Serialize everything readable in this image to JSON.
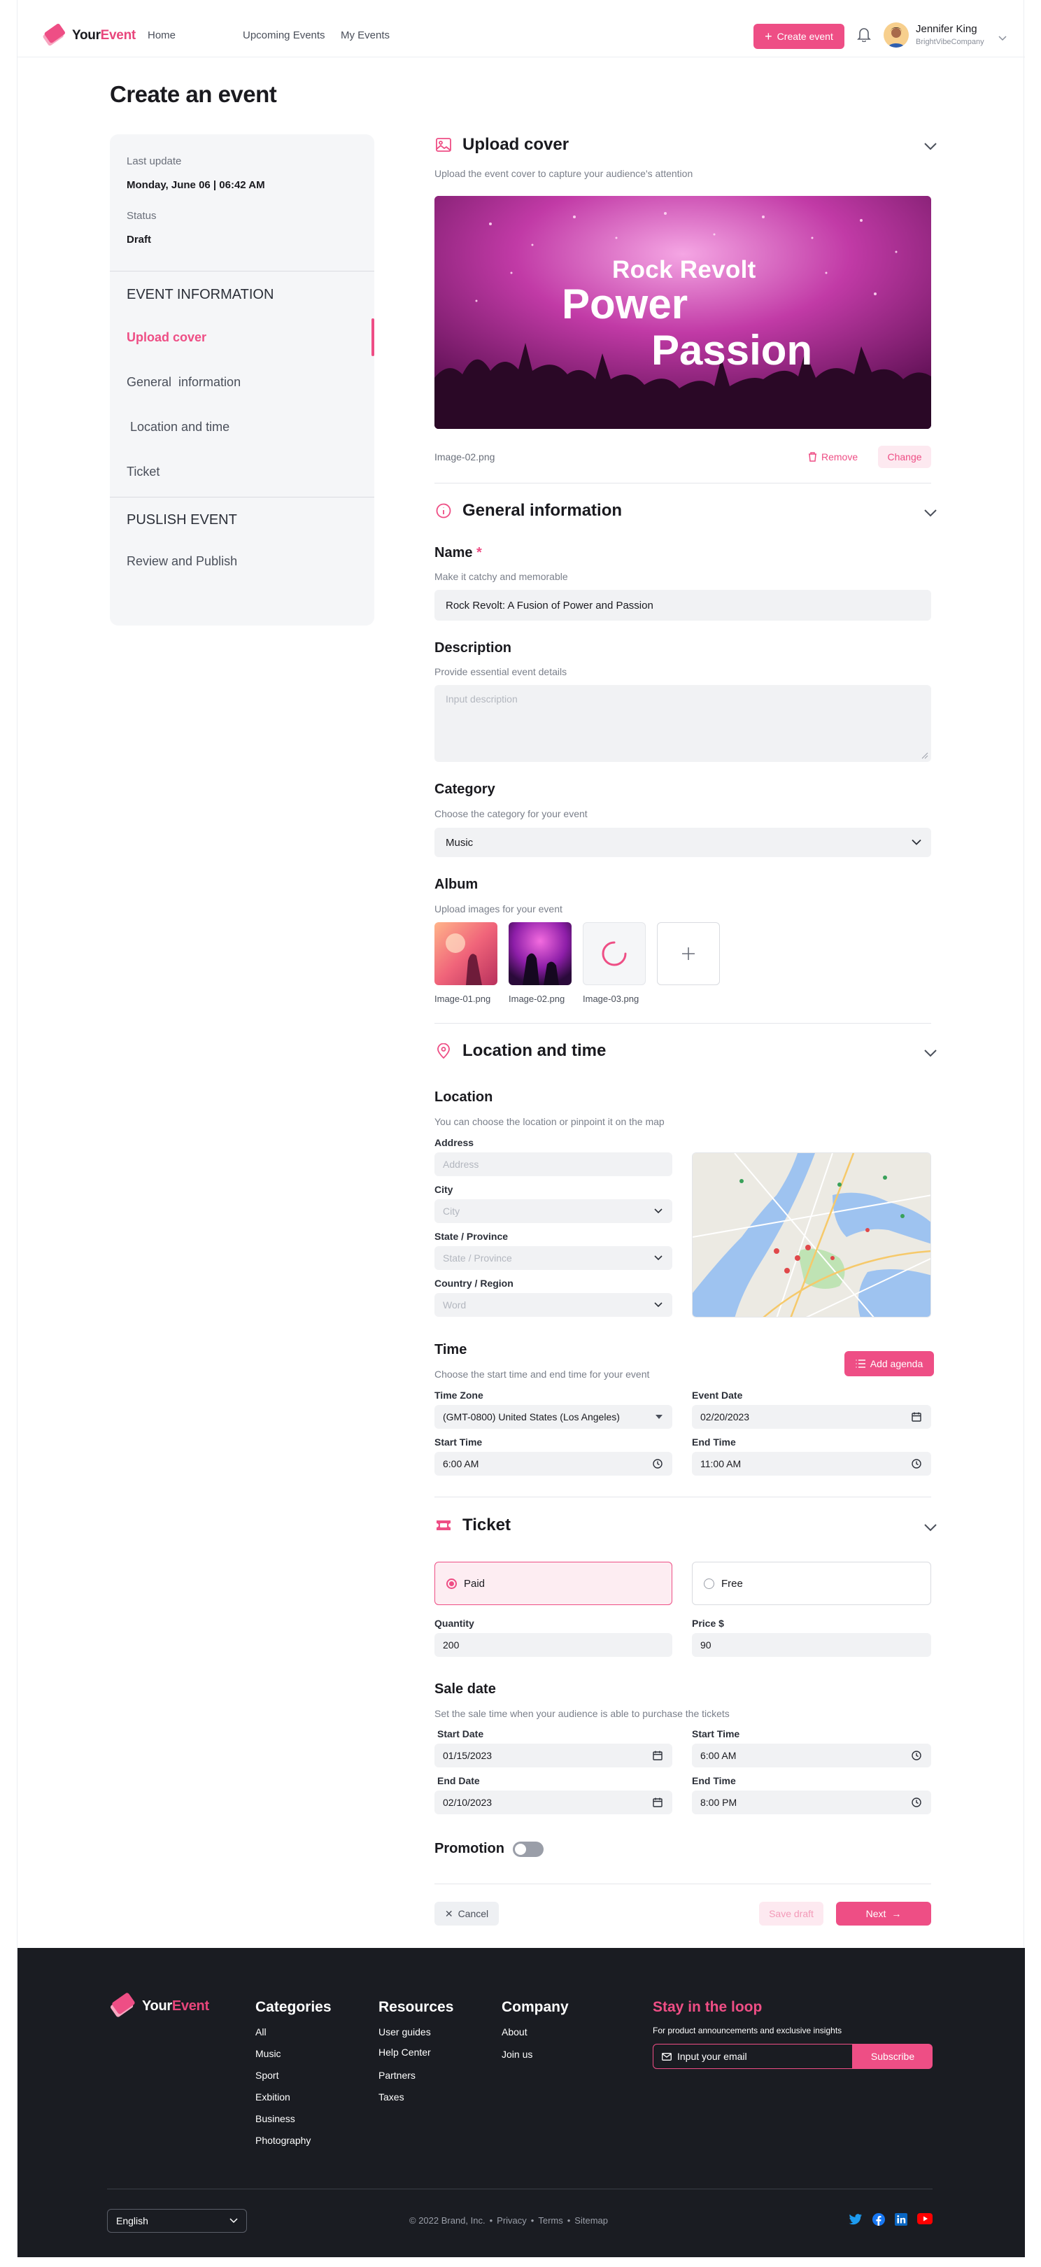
{
  "header": {
    "brand_a": "Your",
    "brand_b": "Event",
    "nav": [
      "Home",
      "Upcoming Events",
      "My Events"
    ],
    "create_label": "Create event",
    "user_name": "Jennifer King",
    "user_company": "BrightVibeCompany"
  },
  "page_title": "Create an event",
  "sidebar": {
    "last_update_label": "Last update",
    "last_update_value": "Monday, June 06 | 06:42 AM",
    "status_label": "Status",
    "status_value": "Draft",
    "event_info_heading": "EVENT INFORMATION",
    "event_items": [
      "Upload cover",
      "General  information",
      " Location and time",
      "Ticket"
    ],
    "publish_heading": "PUSLISH EVENT",
    "publish_items": [
      "Review and Publish"
    ],
    "active_item": "Upload cover"
  },
  "upload_cover": {
    "title": "Upload cover",
    "subtitle": "Upload the event cover to capture your audience's attention",
    "cover_text": [
      "Rock Revolt",
      "Power",
      "Passion"
    ],
    "file_name": "Image-02.png",
    "remove_label": "Remove",
    "change_label": "Change"
  },
  "general": {
    "title": "General information",
    "name_label": "Name",
    "name_required": "*",
    "name_hint": "Make it catchy and memorable",
    "name_value": "Rock Revolt: A Fusion of Power and Passion",
    "description_label": "Description",
    "description_hint": "Provide essential event details",
    "description_placeholder": "Input description",
    "category_label": "Category",
    "category_hint": "Choose the category for your event",
    "category_value": "Music",
    "album_label": "Album",
    "album_hint": "Upload images for your event",
    "album_files": [
      "Image-01.png",
      "Image-02.png",
      "Image-03.png"
    ]
  },
  "location_time": {
    "title": "Location and time",
    "location_label": "Location",
    "location_hint": "You can choose the location or pinpoint it on the map",
    "address_label": "Address",
    "address_placeholder": "Address",
    "city_label": "City",
    "city_placeholder": "City",
    "state_label": "State / Province",
    "state_placeholder": "State / Province",
    "country_label": "Country / Region",
    "country_placeholder": "Word",
    "time_label": "Time",
    "time_hint": "Choose the start time and end time for your event",
    "add_agenda_label": "Add agenda",
    "timezone_label": "Time Zone",
    "timezone_value": "(GMT-0800) United States (Los Angeles)",
    "event_date_label": "Event Date",
    "event_date_value": "02/20/2023",
    "start_time_label": "Start Time",
    "start_time_value": "6:00 AM",
    "end_time_label": "End Time",
    "end_time_value": "11:00 AM"
  },
  "ticket": {
    "title": "Ticket",
    "paid_label": "Paid",
    "free_label": "Free",
    "selected": "Paid",
    "quantity_label": "Quantity",
    "quantity_value": "200",
    "price_label": "Price $",
    "price_value": "90",
    "sale_date_label": "Sale date",
    "sale_date_hint": "Set the sale time when your audience is able to purchase the tickets",
    "start_date_label": "Start Date",
    "start_date_value": "01/15/2023",
    "start_time_label": "Start Time",
    "start_time_value": "6:00 AM",
    "end_date_label": "End Date",
    "end_date_value": "02/10/2023",
    "end_time_label": "End Time",
    "end_time_value": "8:00 PM",
    "promotion_label": "Promotion",
    "promotion_on": false
  },
  "actions": {
    "cancel_label": "Cancel",
    "save_draft_label": "Save draft",
    "next_label": "Next"
  },
  "footer": {
    "brand_a": "Your",
    "brand_b": "Event",
    "categories_heading": "Categories",
    "categories": [
      "All",
      "Music",
      "Sport",
      "Exbition",
      "Business",
      "Photography"
    ],
    "resources_heading": "Resources",
    "resources": [
      "User guides",
      "Help Center",
      "Partners",
      "Taxes"
    ],
    "company_heading": "Company",
    "company": [
      "About",
      "Join us"
    ],
    "newsletter_heading": "Stay in the loop",
    "newsletter_hint": "For product announcements and exclusive insights",
    "email_placeholder": "Input your email",
    "subscribe_label": "Subscribe",
    "language": "English",
    "copyright": "© 2022 Brand, Inc.",
    "legal_links": [
      "Privacy",
      "Terms",
      "Sitemap"
    ],
    "social_icons": [
      "twitter-icon",
      "facebook-icon",
      "linkedin-icon",
      "youtube-icon"
    ]
  },
  "colors": {
    "accent": "#ee4e85",
    "footer_bg": "#1a1c22",
    "field_bg": "#f1f2f4"
  }
}
